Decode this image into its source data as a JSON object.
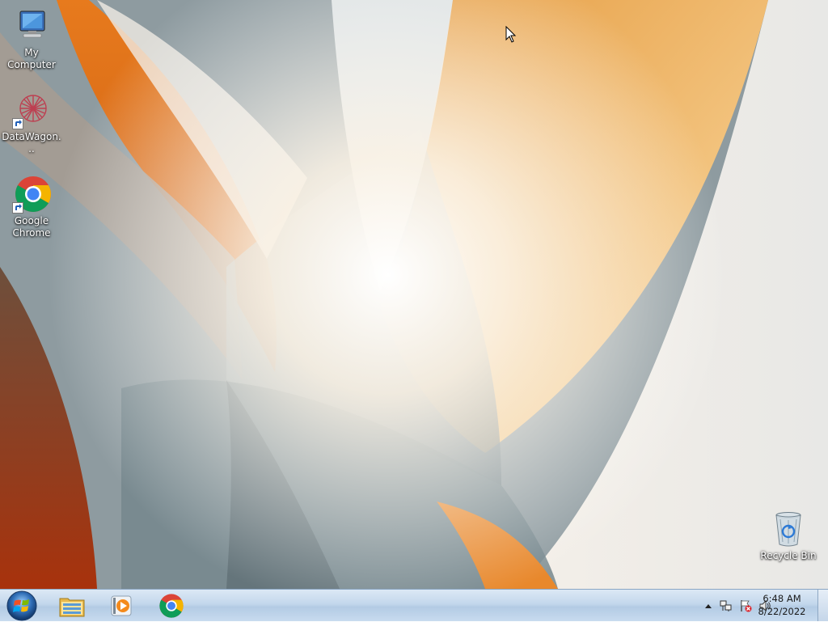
{
  "desktop": {
    "icons": [
      {
        "label": "My Computer",
        "icon": "my-computer-icon"
      },
      {
        "label": "DataWagon...",
        "icon": "datawagon-icon"
      },
      {
        "label": "Google Chrome",
        "icon": "chrome-icon"
      },
      {
        "label": "Recycle Bin",
        "icon": "recycle-bin-icon"
      }
    ]
  },
  "taskbar": {
    "start_icon": "windows-logo-icon",
    "pinned": [
      {
        "icon": "file-explorer-icon"
      },
      {
        "icon": "media-player-icon"
      },
      {
        "icon": "chrome-icon"
      }
    ],
    "tray": {
      "icons": [
        "show-hidden-icons-arrow",
        "network-icon",
        "action-center-flag-icon",
        "volume-icon"
      ],
      "time": "6:48 AM",
      "date": "8/22/2022"
    }
  },
  "colors": {
    "wallpaper_orange": "#e8862a",
    "wallpaper_grey": "#8c9aa0",
    "taskbar": "#c3d7ec"
  }
}
